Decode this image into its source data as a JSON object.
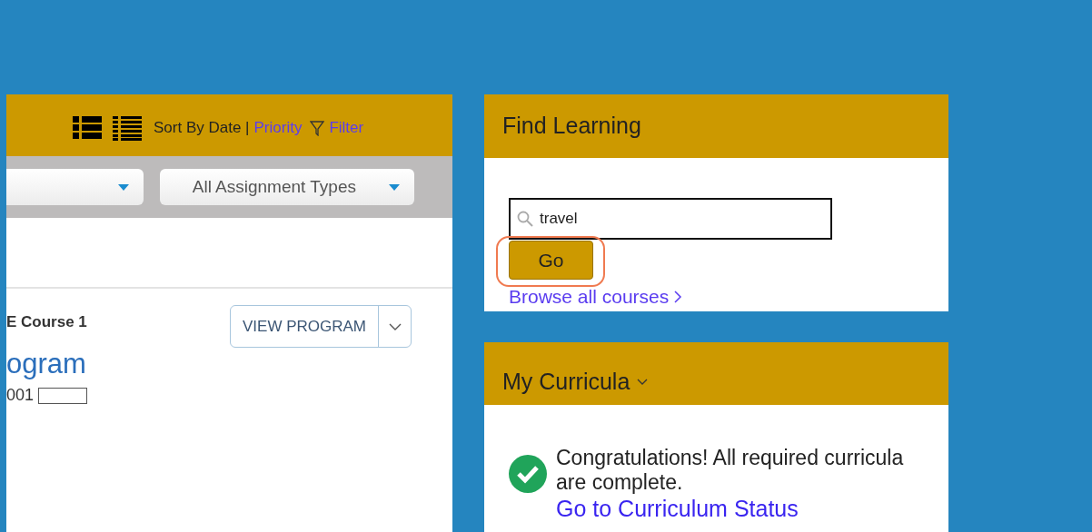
{
  "assignments_panel": {
    "sort_label": "Sort By Date |",
    "sort_options": [
      {
        "label": "Priority"
      }
    ],
    "filter_label": "Filter",
    "filters": [
      {
        "kind": "cut"
      },
      {
        "kind": "full",
        "label": "All Assignment Types"
      }
    ],
    "course": {
      "subtitle": "E Course 1",
      "button": "VIEW PROGRAM",
      "title": "ogram",
      "code": "001"
    }
  },
  "find_learning": {
    "title": "Find Learning",
    "search_value": "travel",
    "go_button": "Go",
    "browse_link": "Browse all courses"
  },
  "my_curricula": {
    "title": "My Curricula",
    "message": "Congratulations! All required curricula are complete.",
    "status_link": "Go to Curriculum Status"
  }
}
